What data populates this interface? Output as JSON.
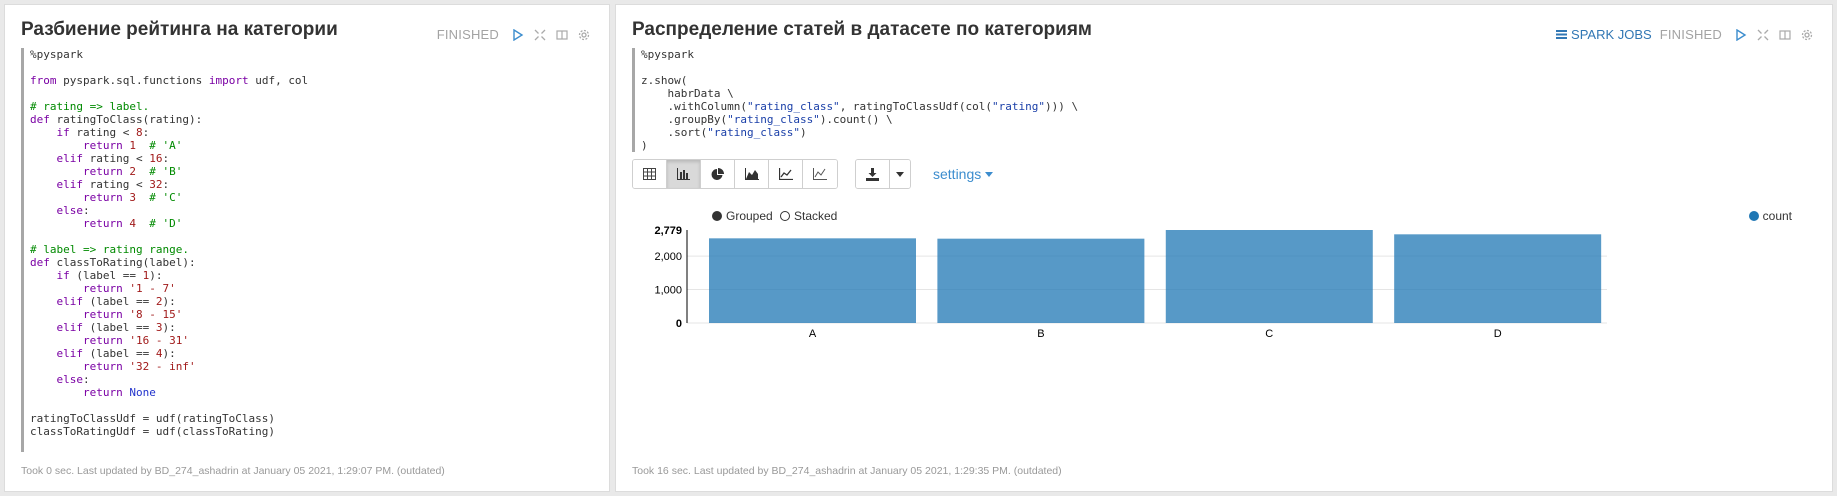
{
  "left": {
    "title": "Разбиение рейтинга на категории",
    "status": "FINISHED",
    "footer": "Took 0 sec. Last updated by BD_274_ashadrin at January 05 2021, 1:29:07 PM. (outdated)"
  },
  "right": {
    "title": "Распределение статей в датасете по категориям",
    "spark_jobs": "SPARK JOBS",
    "status": "FINISHED",
    "settings_label": "settings",
    "footer": "Took 16 sec. Last updated by BD_274_ashadrin at January 05 2021, 1:29:35 PM. (outdated)"
  },
  "icons": {
    "run": "play-icon",
    "fullscreen": "expand-icon",
    "book": "book-icon",
    "gear": "gear-icon",
    "table": "table-icon",
    "bar": "bar-chart-icon",
    "pie": "pie-chart-icon",
    "area": "area-chart-icon",
    "line": "line-chart-icon",
    "scatter": "scatter-chart-icon",
    "download": "download-icon",
    "caret": "caret-down-icon"
  },
  "colors": {
    "bar": "#5a9cca",
    "link": "#3c8dce",
    "spark": "#3177b4"
  },
  "chart_data": {
    "type": "bar",
    "categories": [
      "A",
      "B",
      "C",
      "D"
    ],
    "series": [
      {
        "name": "count",
        "values": [
          2530,
          2520,
          2779,
          2650
        ]
      }
    ],
    "yticks": [
      "0",
      "1,000",
      "2,000",
      "2,779"
    ],
    "ylim": [
      0,
      2779
    ],
    "legend": {
      "grouped": "Grouped",
      "stacked": "Stacked",
      "selected": "grouped"
    },
    "grid": true
  }
}
